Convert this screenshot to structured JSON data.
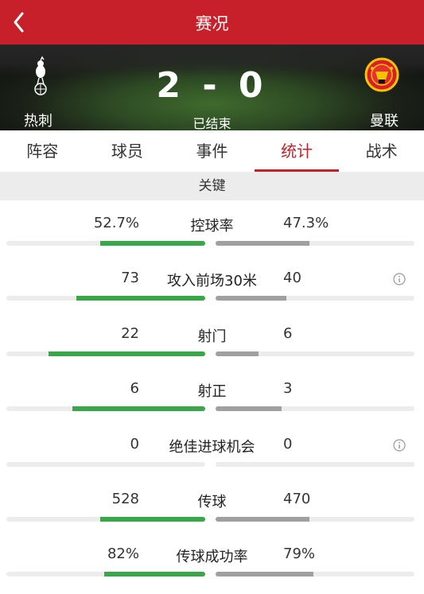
{
  "header": {
    "title": "赛况"
  },
  "match": {
    "home_team": "热刺",
    "away_team": "曼联",
    "score": "2 - 0",
    "status": "已结束"
  },
  "tabs": [
    {
      "label": "阵容"
    },
    {
      "label": "球员"
    },
    {
      "label": "事件"
    },
    {
      "label": "统计",
      "active": true
    },
    {
      "label": "战术"
    }
  ],
  "section": {
    "title": "关键"
  },
  "stats": [
    {
      "label": "控球率",
      "home": "52.7%",
      "away": "47.3%",
      "home_fill": 0.527,
      "away_fill": 0.473,
      "info": false
    },
    {
      "label": "攻入前场30米",
      "home": "73",
      "away": "40",
      "home_fill": 0.646,
      "away_fill": 0.354,
      "info": true
    },
    {
      "label": "射门",
      "home": "22",
      "away": "6",
      "home_fill": 0.786,
      "away_fill": 0.214,
      "info": false
    },
    {
      "label": "射正",
      "home": "6",
      "away": "3",
      "home_fill": 0.667,
      "away_fill": 0.333,
      "info": false
    },
    {
      "label": "绝佳进球机会",
      "home": "0",
      "away": "0",
      "home_fill": 0,
      "away_fill": 0,
      "info": true
    },
    {
      "label": "传球",
      "home": "528",
      "away": "470",
      "home_fill": 0.529,
      "away_fill": 0.471,
      "info": false
    },
    {
      "label": "传球成功率",
      "home": "82%",
      "away": "79%",
      "home_fill": 0.509,
      "away_fill": 0.491,
      "info": false
    }
  ],
  "colors": {
    "brand_red": "#c8202a",
    "home_bar": "#3aa64a",
    "away_bar": "#a0a0a0"
  }
}
